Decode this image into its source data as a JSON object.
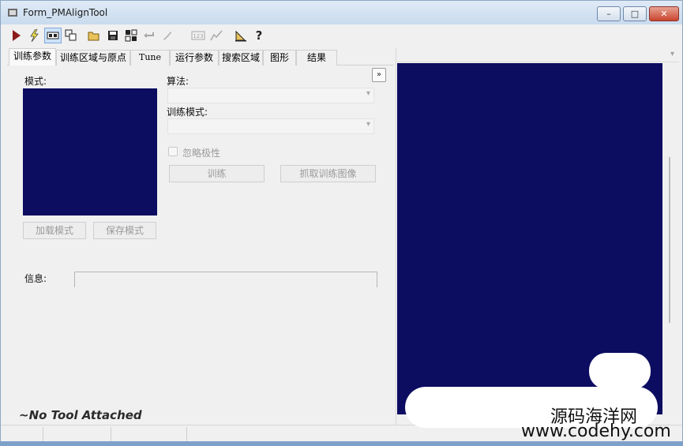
{
  "window": {
    "title": "Form_PMAlignTool",
    "buttons": {
      "minimize": "–",
      "maximize": "□",
      "close": "✕"
    }
  },
  "toolbar": {
    "icons": [
      "run-icon",
      "lightning-icon",
      "toggle-display-icon",
      "graphics-icon",
      "open-folder-icon",
      "save-icon",
      "grid-icon",
      "reset-icon",
      "tool-icon",
      "numeric-icon",
      "checkmark-icon",
      "ruler-icon",
      "help-icon"
    ]
  },
  "tabs": [
    {
      "label": "训练参数",
      "active": true
    },
    {
      "label": "训练区域与原点",
      "active": false
    },
    {
      "label": "Tune",
      "active": false
    },
    {
      "label": "运行参数",
      "active": false
    },
    {
      "label": "搜索区域",
      "active": false
    },
    {
      "label": "图形",
      "active": false
    },
    {
      "label": "结果",
      "active": false
    }
  ],
  "training": {
    "model_label": "模式:",
    "algorithm_label": "算法:",
    "algorithm_value": "",
    "train_mode_label": "训练模式:",
    "train_mode_value": "",
    "ignore_polarity_label": "忽略极性",
    "ignore_polarity_checked": false,
    "train_button": "训练",
    "grab_image_button": "抓取训练图像",
    "load_model_button": "加载模式",
    "save_model_button": "保存模式",
    "info_label": "信息:",
    "info_value": "",
    "collapse_symbol": "»"
  },
  "status": {
    "no_tool": "~No Tool Attached"
  },
  "watermark": {
    "chinese": "源码海洋网",
    "url": "www.codehy.com"
  },
  "colors": {
    "display_background": "#0c0c61",
    "window_background": "#f0f0f0",
    "run_icon": "#8b1a1a"
  }
}
